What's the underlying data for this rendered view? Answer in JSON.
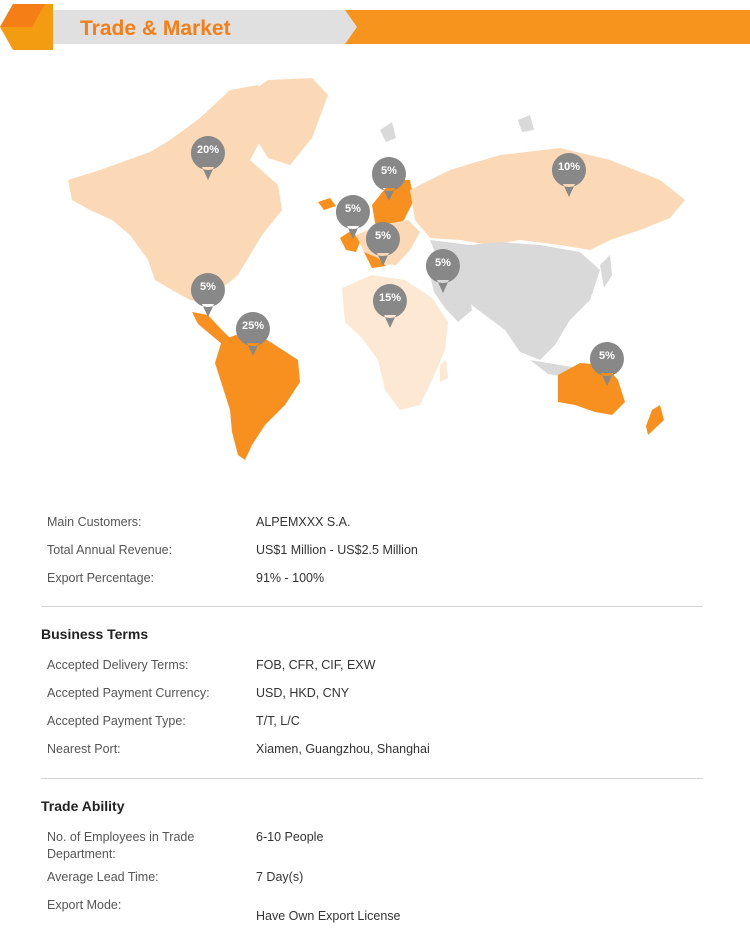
{
  "header": {
    "title": "Trade & Market"
  },
  "map": {
    "markets": [
      {
        "region": "North America",
        "percent": "20%"
      },
      {
        "region": "Central America",
        "percent": "5%"
      },
      {
        "region": "South America",
        "percent": "25%"
      },
      {
        "region": "Western Europe",
        "percent": "5%"
      },
      {
        "region": "Northern Europe",
        "percent": "5%"
      },
      {
        "region": "Southern Europe",
        "percent": "5%"
      },
      {
        "region": "Eastern Europe",
        "percent": "10%"
      },
      {
        "region": "Mid East",
        "percent": "5%"
      },
      {
        "region": "Africa",
        "percent": "15%"
      },
      {
        "region": "Oceania",
        "percent": "5%"
      }
    ],
    "colors": {
      "light": "#fcd9b6",
      "pale": "#fde8d3",
      "strong": "#f7901e",
      "grey": "#d9d9d9",
      "pin": "#888888"
    }
  },
  "overview": [
    {
      "label": "Main Customers:",
      "value": "ALPEMXXX S.A."
    },
    {
      "label": "Total Annual Revenue:",
      "value": "US$1 Million - US$2.5 Million"
    },
    {
      "label": "Export Percentage:",
      "value": "91% - 100%"
    }
  ],
  "business_terms": {
    "title": "Business Terms",
    "rows": [
      {
        "label": "Accepted Delivery Terms:",
        "value": "FOB, CFR, CIF, EXW"
      },
      {
        "label": "Accepted Payment Currency:",
        "value": "USD, HKD, CNY"
      },
      {
        "label": "Accepted Payment Type:",
        "value": "T/T, L/C"
      },
      {
        "label": "Nearest Port:",
        "value": "Xiamen, Guangzhou, Shanghai"
      }
    ]
  },
  "trade_ability": {
    "title": "Trade Ability",
    "rows": [
      {
        "label": "No. of Employees in Trade Department:",
        "value": "6-10 People"
      },
      {
        "label": "Average Lead Time:",
        "value": "7 Day(s)"
      },
      {
        "label": "Export Mode:",
        "value": "Have Own Export License"
      }
    ]
  }
}
